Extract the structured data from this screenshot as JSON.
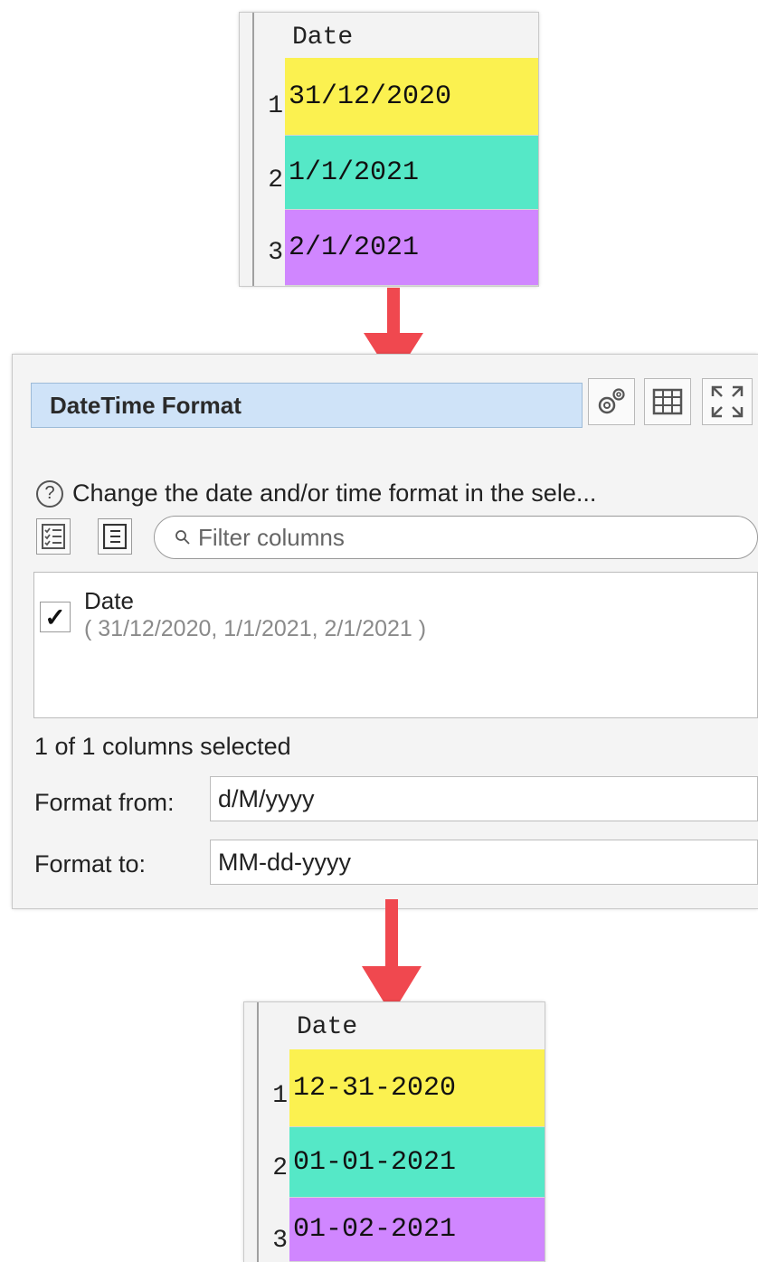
{
  "input_table": {
    "header": "Date",
    "rows": [
      {
        "num": "1",
        "value": "31/12/2020",
        "color": "#fbf150"
      },
      {
        "num": "2",
        "value": "1/1/2021",
        "color": "#55e8c7"
      },
      {
        "num": "3",
        "value": "2/1/2021",
        "color": "#d086ff"
      }
    ]
  },
  "panel": {
    "title": "DateTime Format",
    "description": "Change the date and/or time format in the sele...",
    "filter_placeholder": "Filter columns",
    "column": {
      "name": "Date",
      "checked": true,
      "sample_values": "( 31/12/2020, 1/1/2021, 2/1/2021 )"
    },
    "status": "1 of 1 columns selected",
    "format_from_label": "Format from:",
    "format_from_value": "d/M/yyyy",
    "format_to_label": "Format to:",
    "format_to_value": "MM-dd-yyyy"
  },
  "output_table": {
    "header": "Date",
    "rows": [
      {
        "num": "1",
        "value": "12-31-2020",
        "color": "#fbf150"
      },
      {
        "num": "2",
        "value": "01-01-2021",
        "color": "#55e8c7"
      },
      {
        "num": "3",
        "value": "01-02-2021",
        "color": "#d086ff"
      }
    ]
  },
  "colors": {
    "arrow": "#f0484f",
    "title_bar": "#cfe3f8"
  },
  "icons": [
    "gears-icon",
    "table-icon",
    "expand-icon",
    "help-icon",
    "checklist-icon",
    "list-icon",
    "search-icon",
    "check-icon",
    "down-arrow-icon"
  ]
}
